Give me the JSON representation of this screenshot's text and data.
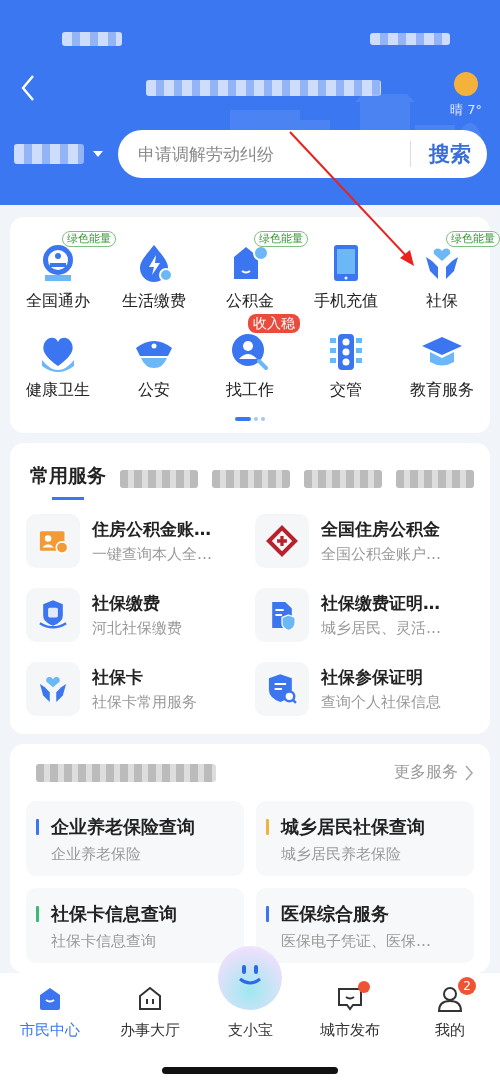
{
  "header": {
    "weather": "晴 7°",
    "search": {
      "placeholder": "申请调解劳动纠纷",
      "button": "搜索"
    }
  },
  "quick_services": {
    "items": [
      {
        "label": "全国通办",
        "kind": "globe",
        "badge": {
          "text": "绿色能量",
          "kind": "energy"
        }
      },
      {
        "label": "生活缴费",
        "kind": "bolt"
      },
      {
        "label": "公积金",
        "kind": "fund",
        "badge": {
          "text": "绿色能量",
          "kind": "energy"
        }
      },
      {
        "label": "手机充值",
        "kind": "phone"
      },
      {
        "label": "社保",
        "kind": "hands",
        "badge": {
          "text": "绿色能量",
          "kind": "energy"
        }
      },
      {
        "label": "健康卫生",
        "kind": "heart"
      },
      {
        "label": "公安",
        "kind": "cap"
      },
      {
        "label": "找工作",
        "kind": "person-search",
        "badge": {
          "text": "收入稳",
          "kind": "hot"
        }
      },
      {
        "label": "交管",
        "kind": "traffic"
      },
      {
        "label": "教育服务",
        "kind": "grad"
      }
    ],
    "pager": [
      {
        "selected": true
      },
      {
        "selected": false
      },
      {
        "selected": false
      }
    ]
  },
  "common_services": {
    "tabs": [
      {
        "label": "常用服务",
        "selected": true
      }
    ],
    "items": [
      {
        "title": "住房公积金账…",
        "subtitle": "一键查询本人全…",
        "kind": "card-user"
      },
      {
        "title": "全国住房公积金",
        "subtitle": "全国公积金账户…",
        "kind": "diamond-logo"
      },
      {
        "title": "社保缴费",
        "subtitle": "河北社保缴费",
        "kind": "bao-shield"
      },
      {
        "title": "社保缴费证明…",
        "subtitle": "城乡居民、灵活…",
        "kind": "doc-shield"
      },
      {
        "title": "社保卡",
        "subtitle": "社保卡常用服务",
        "kind": "hands"
      },
      {
        "title": "社保参保证明",
        "subtitle": "查询个人社保信息",
        "kind": "shield-search"
      }
    ]
  },
  "zone": {
    "more": "更多服务",
    "items": [
      {
        "title": "企业养老保险查询",
        "subtitle": "企业养老保险",
        "color": "#3b76f0"
      },
      {
        "title": "城乡居民社保查询",
        "subtitle": "城乡居民养老保险",
        "color": "#f0b43c"
      },
      {
        "title": "社保卡信息查询",
        "subtitle": "社保卡信息查询",
        "color": "#3cb878"
      },
      {
        "title": "医保综合服务",
        "subtitle": "医保电子凭证、医保…",
        "color": "#3b76f0"
      }
    ]
  },
  "tab_bar": [
    {
      "label": "市民中心",
      "kind": "home",
      "selected": true
    },
    {
      "label": "办事大厅",
      "kind": "hall",
      "selected": false
    },
    {
      "label": "支小宝",
      "kind": "mascot",
      "selected": false
    },
    {
      "label": "城市发布",
      "kind": "chat",
      "selected": false,
      "dot": true
    },
    {
      "label": "我的",
      "kind": "user",
      "selected": false,
      "badge": "2"
    }
  ],
  "annotation_arrow": true
}
